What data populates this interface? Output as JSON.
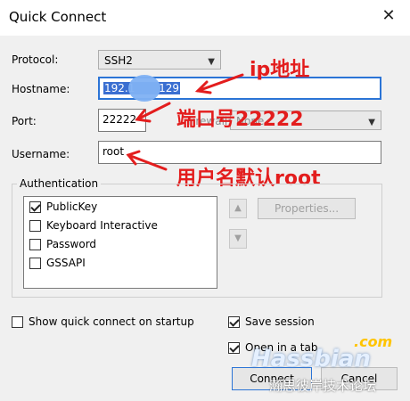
{
  "window": {
    "title": "Quick Connect",
    "close": "✕"
  },
  "labels": {
    "protocol": "Protocol:",
    "hostname": "Hostname:",
    "port": "Port:",
    "firewall": "Firewall:",
    "username": "Username:"
  },
  "fields": {
    "protocol": "SSH2",
    "hostname_prefix": "192.1",
    "hostname_suffix": "129",
    "port": "22222",
    "firewall": "None",
    "username": "root"
  },
  "annotations": {
    "ip": "ip地址",
    "port": "端口号22222",
    "user": "用户名默认root"
  },
  "auth": {
    "title": "Authentication",
    "items": [
      {
        "label": "PublicKey",
        "checked": true
      },
      {
        "label": "Keyboard Interactive",
        "checked": false
      },
      {
        "label": "Password",
        "checked": false
      },
      {
        "label": "GSSAPI",
        "checked": false
      }
    ],
    "properties_button": "Properties..."
  },
  "options": {
    "show_quick_connect": "Show quick connect on startup",
    "save_session": "Save session",
    "open_in_tab": "Open in a tab"
  },
  "buttons": {
    "connect": "Connect",
    "cancel": "Cancel"
  },
  "watermark": {
    "brand": "Hassbian",
    "com": ".com",
    "cn": "瀚思彼岸技术论坛"
  },
  "colors": {
    "annotation": "#e31d1d",
    "selection": "#3b6fd1",
    "focus_border": "#2b74d6"
  }
}
